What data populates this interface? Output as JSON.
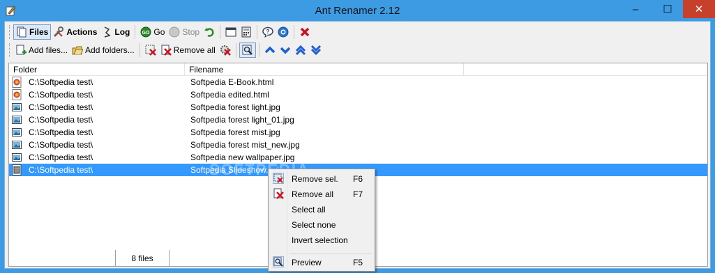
{
  "window": {
    "title": "Ant Renamer 2.12"
  },
  "title_buttons": {
    "minimize": "–",
    "maximize": "☐",
    "close": "✕"
  },
  "toolbar1": {
    "files": "Files",
    "actions": "Actions",
    "log": "Log",
    "go": "Go",
    "stop": "Stop"
  },
  "toolbar2": {
    "add_files": "Add files...",
    "add_folders": "Add folders...",
    "remove_all": "Remove all"
  },
  "list": {
    "columns": [
      "Folder",
      "Filename"
    ],
    "rows": [
      {
        "folder": "C:\\Softpedia test\\",
        "filename": "Softpedia E-Book.html",
        "icon": "html-file-icon"
      },
      {
        "folder": "C:\\Softpedia test\\",
        "filename": "Softpedia edited.html",
        "icon": "html-file-icon"
      },
      {
        "folder": "C:\\Softpedia test\\",
        "filename": "Softpedia forest light.jpg",
        "icon": "image-file-icon"
      },
      {
        "folder": "C:\\Softpedia test\\",
        "filename": "Softpedia forest light_01.jpg",
        "icon": "image-file-icon"
      },
      {
        "folder": "C:\\Softpedia test\\",
        "filename": "Softpedia forest mist.jpg",
        "icon": "image-file-icon"
      },
      {
        "folder": "C:\\Softpedia test\\",
        "filename": "Softpedia forest mist_new.jpg",
        "icon": "image-file-icon"
      },
      {
        "folder": "C:\\Softpedia test\\",
        "filename": "Softpedia new wallpaper.jpg",
        "icon": "image-file-icon"
      },
      {
        "folder": "C:\\Softpedia test\\",
        "filename": "Softpedia Slideshow.avi",
        "icon": "video-file-icon",
        "selected": true
      }
    ]
  },
  "status": {
    "file_count": "8 files"
  },
  "context_menu": {
    "items": [
      {
        "label": "Remove sel.",
        "shortcut": "F6"
      },
      {
        "label": "Remove all",
        "shortcut": "F7"
      },
      {
        "label": "Select all",
        "shortcut": ""
      },
      {
        "label": "Select none",
        "shortcut": ""
      },
      {
        "label": "Invert selection",
        "shortcut": ""
      },
      {
        "label": "Preview",
        "shortcut": "F5"
      }
    ]
  },
  "watermark": "SOFTPEDIA",
  "colors": {
    "titlebar": "#3c9be3",
    "selection": "#3399ff",
    "close": "#c7402c",
    "arrow_blue": "#1f5fcf"
  }
}
